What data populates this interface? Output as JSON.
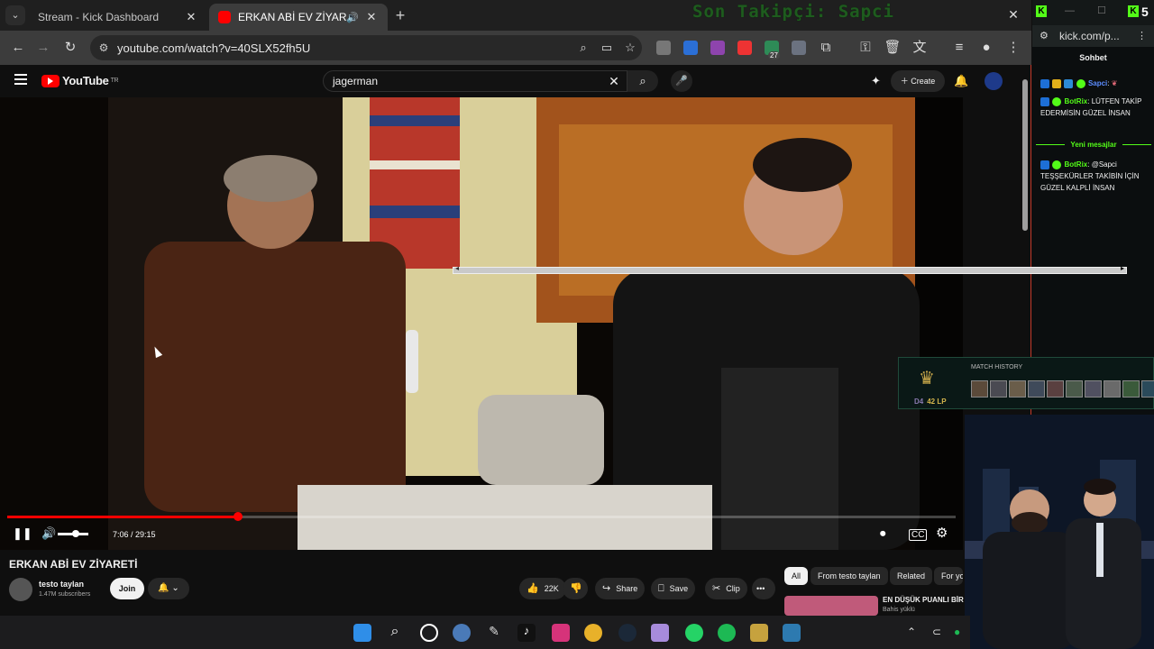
{
  "browser": {
    "tabs": [
      {
        "title": "Stream - Kick Dashboard",
        "favicon": "kick-icon"
      },
      {
        "title": "ERKAN ABİ EV ZİYARETİ - Yo",
        "favicon": "youtube-icon",
        "audio": true,
        "active": true
      }
    ],
    "new_tab": "+",
    "ticker": "Son Takipçi: Sapci",
    "close": "✕",
    "url": "youtube.com/watch?v=40SLX52fh5U",
    "ext_badge": "27"
  },
  "youtube": {
    "logo": "YouTube",
    "region": "TR",
    "search_value": "jagerman",
    "create_label": "Create",
    "player": {
      "time": "7:06 / 29:15",
      "progress_fraction": 0.243
    },
    "video_title": "ERKAN ABİ EV ZİYARETİ",
    "channel_name": "testo taylan",
    "subscribers": "1.47M subscribers",
    "join_label": "Join",
    "like_count": "22K",
    "share_label": "Share",
    "save_label": "Save",
    "clip_label": "Clip",
    "more_label": "•••",
    "chips": [
      "All",
      "From testo taylan",
      "Related",
      "For yo"
    ],
    "rec_title": "EN DÜŞÜK PUANLI BİR",
    "rec_sub": "Bahis yüklü"
  },
  "kick": {
    "count": "5",
    "url": "kick.com/p...",
    "chat_header": "Sohbet",
    "new_messages": "Yeni mesajlar",
    "messages": [
      {
        "user": "Sapci",
        "text": "",
        "user_color": "#5b8cff"
      },
      {
        "user": "BotRix",
        "text": "LÜTFEN TAKİP EDERMİSİN GÜZEL İNSAN",
        "user_color": "#53fc18"
      },
      {
        "user": "BotRix",
        "text": "@Sapci TEŞŞEKÜRLER TAKİBİN İÇİN GÜZEL KALPLİ İNSAN",
        "user_color": "#53fc18"
      }
    ]
  },
  "overlay": {
    "rank_prefix": "D4",
    "lp": "42 LP",
    "match_history": "MATCH HISTORY"
  },
  "colors": {
    "accent_kick": "#53fc18",
    "yt_red": "#ff0000"
  }
}
